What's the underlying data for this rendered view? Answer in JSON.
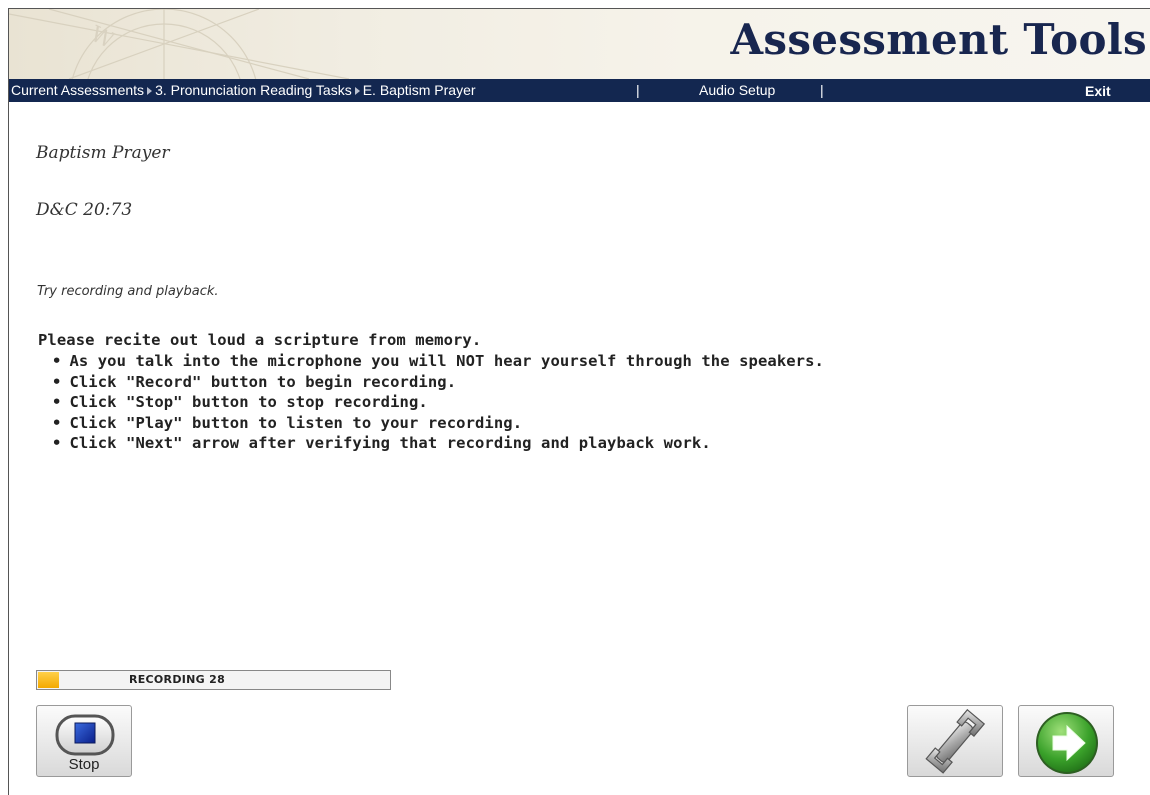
{
  "header": {
    "app_title": "Assessment Tools"
  },
  "nav": {
    "breadcrumbs": [
      "Current Assessments",
      "3. Pronunciation Reading Tasks",
      "E. Baptism Prayer"
    ],
    "separator": "|",
    "audio_setup_label": "Audio Setup",
    "exit_label": "Exit"
  },
  "content": {
    "title": "Baptism Prayer",
    "reference": "D&C 20:73",
    "hint": "Try recording and playback.",
    "lead": "Please recite out loud a scripture from memory.",
    "steps": [
      "As you talk into the microphone you will NOT hear yourself through the speakers.",
      "Click \"Record\" button to begin recording.",
      "Click \"Stop\" button to stop recording.",
      "Click \"Play\" button to listen to your recording.",
      "Click \"Next\" arrow after verifying that recording and playback work."
    ]
  },
  "recorder": {
    "status_label": "RECORDING 28",
    "progress_fraction": 0.06,
    "progress_color": "#f4a900",
    "stop_label": "Stop",
    "stop_icon": "stop-square-icon",
    "setup_icon": "wrench-icon",
    "next_icon": "next-arrow-icon"
  },
  "colors": {
    "nav_background": "#132750",
    "title_color": "#18264f",
    "next_button_green": "#3aa12a"
  }
}
